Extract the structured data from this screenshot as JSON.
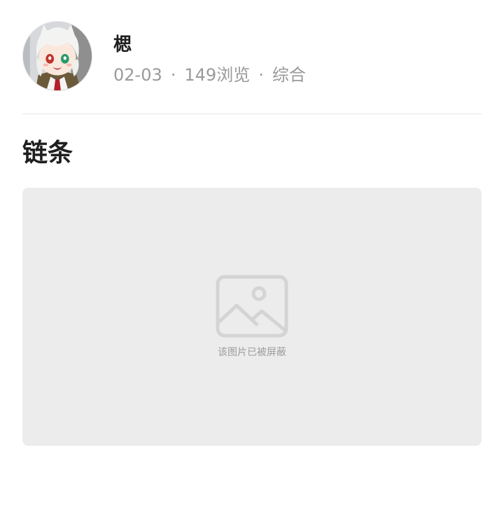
{
  "author": {
    "name": "楒",
    "avatar_icon": "anime-avatar-icon"
  },
  "meta": {
    "date": "02-03",
    "separator": "·",
    "views": "149浏览",
    "category": "综合"
  },
  "post": {
    "title": "链条"
  },
  "blocked_image": {
    "icon": "image-placeholder-icon",
    "caption": "该图片已被屏蔽"
  },
  "colors": {
    "background": "#ffffff",
    "text_primary": "#1f1f1f",
    "text_secondary": "#9a9a9a",
    "divider": "#e6e6e6",
    "placeholder_bg": "#ececec",
    "placeholder_icon": "#d4d4d4"
  }
}
